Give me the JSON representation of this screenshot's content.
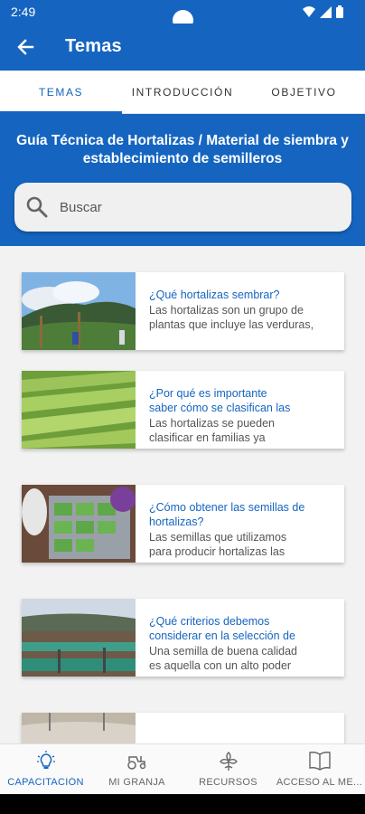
{
  "status_bar": {
    "time": "2:49"
  },
  "app_bar": {
    "title": "Temas"
  },
  "tabs": [
    {
      "label": "TEMAS",
      "active": true
    },
    {
      "label": "INTRODUCCIÓN",
      "active": false
    },
    {
      "label": "OBJETIVO",
      "active": false
    }
  ],
  "guide": {
    "title_line1": "Guía Técnica de Hortalizas / Material de siembra y",
    "title_line2": "establecimiento de semilleros"
  },
  "search": {
    "placeholder": "Buscar"
  },
  "cards": [
    {
      "title": "¿Qué hortalizas sembrar?",
      "title2": "",
      "desc": "Las hortalizas son un grupo de",
      "desc2": "plantas que incluye las verduras,"
    },
    {
      "title": "¿Por qué es importante",
      "title2": "saber cómo se  clasifican las",
      "desc": "Las hortalizas se pueden",
      "desc2": "clasificar en familias ya"
    },
    {
      "title": "¿Cómo obtener las semillas de",
      "title2": "hortalizas?",
      "desc": "Las semillas que utilizamos",
      "desc2": "para producir hortalizas las"
    },
    {
      "title": "¿Qué criterios debemos",
      "title2": "considerar en la selección de",
      "desc": "Una semilla de buena calidad",
      "desc2": "es aquella con un alto poder"
    }
  ],
  "bottom_nav": [
    {
      "label": "CAPACITACIÓN",
      "icon": "lightbulb-icon",
      "active": true
    },
    {
      "label": "MI GRANJA",
      "icon": "tractor-icon",
      "active": false
    },
    {
      "label": "RECURSOS",
      "icon": "plant-icon",
      "active": false
    },
    {
      "label": "ACCESO AL ME...",
      "icon": "book-icon",
      "active": false
    }
  ],
  "colors": {
    "primary": "#1565c0",
    "background": "#f2f2f2"
  }
}
